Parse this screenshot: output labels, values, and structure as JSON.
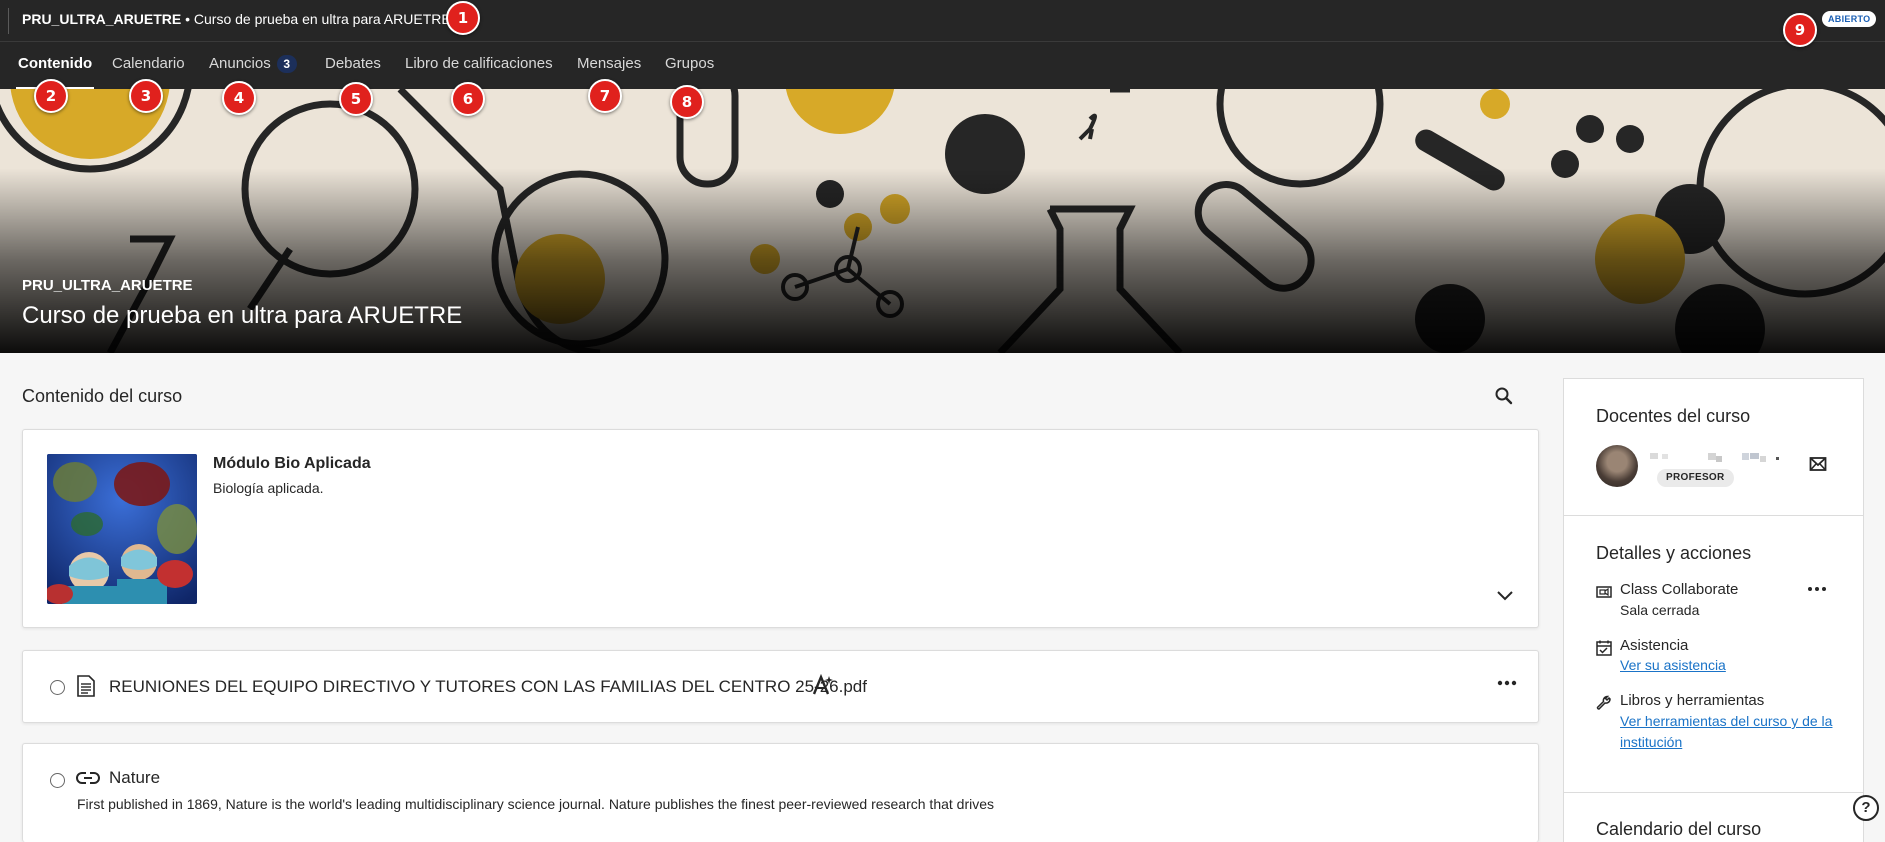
{
  "topbar": {
    "course_code": "PRU_ULTRA_ARUETRE",
    "separator": " • ",
    "course_name": "Curso de prueba en ultra para ARUETRE",
    "status_badge": "ABIERTO"
  },
  "nav": {
    "tabs": [
      {
        "label": "Contenido",
        "active": true
      },
      {
        "label": "Calendario"
      },
      {
        "label": "Anuncios",
        "count": "3"
      },
      {
        "label": "Debates"
      },
      {
        "label": "Libro de calificaciones"
      },
      {
        "label": "Mensajes"
      },
      {
        "label": "Grupos"
      }
    ]
  },
  "markers": [
    "1",
    "2",
    "3",
    "4",
    "5",
    "6",
    "7",
    "8",
    "9"
  ],
  "banner": {
    "course_code": "PRU_ULTRA_ARUETRE",
    "course_name": "Curso de prueba en ultra para ARUETRE"
  },
  "content": {
    "section_title": "Contenido del curso",
    "items": [
      {
        "type": "module",
        "title": "Módulo Bio Aplicada",
        "description": "Biología aplicada."
      },
      {
        "type": "document",
        "title": "REUNIONES DEL EQUIPO DIRECTIVO Y TUTORES CON LAS FAMILIAS DEL CENTRO 25-26.pdf"
      },
      {
        "type": "link",
        "title": "Nature",
        "description": "First published in 1869, Nature is the world's leading multidisciplinary science journal. Nature publishes the finest peer-reviewed research that drives"
      }
    ]
  },
  "sidebar": {
    "teachers_title": "Docentes del curso",
    "teacher_role": "PROFESOR",
    "details_title": "Detalles y acciones",
    "details": [
      {
        "label": "Class Collaborate",
        "sub": "Sala cerrada"
      },
      {
        "label": "Asistencia",
        "link": "Ver su asistencia"
      },
      {
        "label": "Libros y herramientas",
        "link": "Ver herramientas del curso y de la institución"
      }
    ],
    "calendar_title": "Calendario del curso"
  },
  "colors": {
    "topbar_bg": "#262626",
    "marker": "#e0211d",
    "link": "#1a73c7",
    "badge_text": "#1a5fb4"
  }
}
